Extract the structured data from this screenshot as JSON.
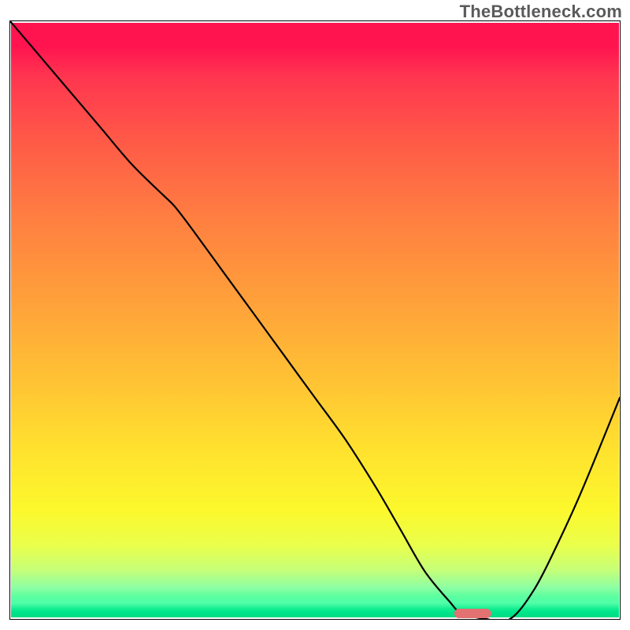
{
  "watermark": {
    "text": "TheBottleneck.com"
  },
  "chart_data": {
    "type": "line",
    "title": "",
    "xlabel": "",
    "ylabel": "",
    "xlim": [
      0,
      100
    ],
    "ylim": [
      0,
      100
    ],
    "grid": false,
    "legend": null,
    "annotations": [],
    "background": {
      "type": "vertical-gradient",
      "stops": [
        {
          "pos": 0.0,
          "color": "#ff1450"
        },
        {
          "pos": 0.33,
          "color": "#ff7f41"
        },
        {
          "pos": 0.6,
          "color": "#ffc234"
        },
        {
          "pos": 0.82,
          "color": "#fcf82c"
        },
        {
          "pos": 0.95,
          "color": "#8cffa3"
        },
        {
          "pos": 1.0,
          "color": "#00dc84"
        }
      ]
    },
    "series": [
      {
        "name": "bottleneck-curve",
        "color": "#000000",
        "x": [
          0,
          5,
          10,
          15,
          20,
          25,
          27,
          30,
          35,
          40,
          45,
          50,
          55,
          60,
          64,
          68,
          72,
          74,
          78,
          82,
          86,
          90,
          94,
          100
        ],
        "y": [
          100,
          94,
          88,
          82,
          76,
          71,
          69,
          65,
          58,
          51,
          44,
          37,
          30,
          22,
          15,
          8,
          3,
          1,
          0,
          0,
          5,
          13,
          22,
          37
        ]
      }
    ],
    "marker": {
      "name": "optimal-region",
      "shape": "rounded-bar",
      "color": "#e27171",
      "x_center": 76,
      "y": 0,
      "width_x_units": 6
    }
  }
}
